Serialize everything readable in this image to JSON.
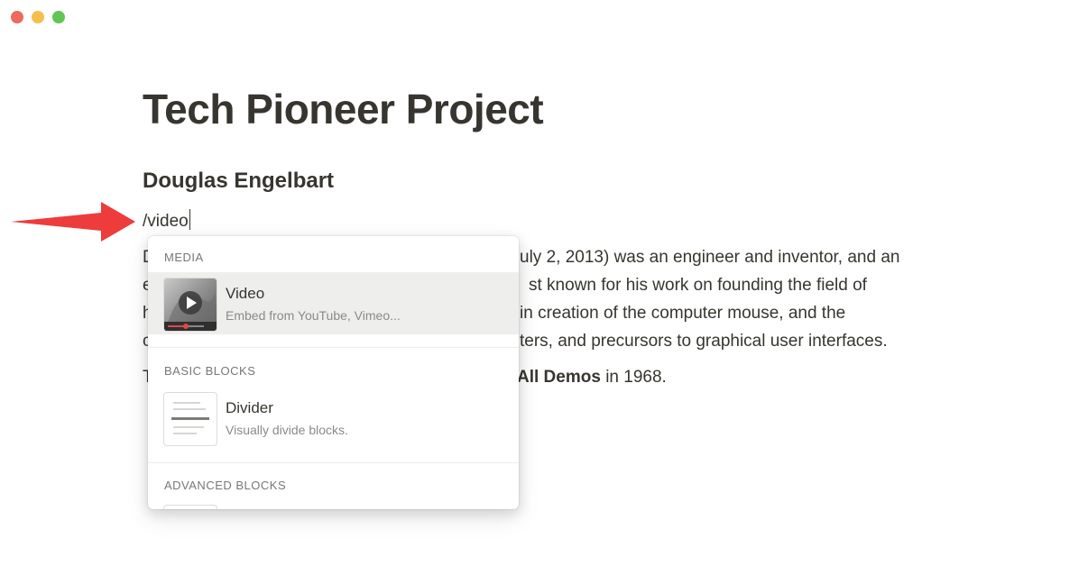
{
  "window": {
    "traffic_lights": {
      "close": "#ed6a5e",
      "minimize": "#f5bf4f",
      "zoom": "#61c554"
    }
  },
  "page": {
    "title": "Tech Pioneer Project",
    "heading": "Douglas Engelbart",
    "slash_input": "/video",
    "body_lines": [
      {
        "lead": "D",
        "tail": "uly 2, 2013) was an engineer and inventor, and an"
      },
      {
        "lead": "e",
        "tail": "st known for his work on founding the field of"
      },
      {
        "lead": "h",
        "tail": "in creation of the computer mouse, and the"
      },
      {
        "lead": "c",
        "tail": "ters, and precursors to graphical user interfaces."
      },
      {
        "lead": "T",
        "tail_bold": "All Demos",
        "tail_rest": " in 1968."
      }
    ]
  },
  "annotation": {
    "arrow_color": "#ee3b3b",
    "arrow_icon": "red-arrow-icon"
  },
  "menu": {
    "sections": [
      {
        "label": "MEDIA"
      },
      {
        "label": "BASIC BLOCKS"
      },
      {
        "label": "ADVANCED BLOCKS"
      }
    ],
    "items": [
      {
        "title": "Video",
        "description": "Embed from YouTube, Vimeo...",
        "icon": "video-thumbnail-icon",
        "selected": true
      },
      {
        "title": "Divider",
        "description": "Visually divide blocks.",
        "icon": "divider-thumbnail-icon",
        "selected": false
      }
    ]
  }
}
